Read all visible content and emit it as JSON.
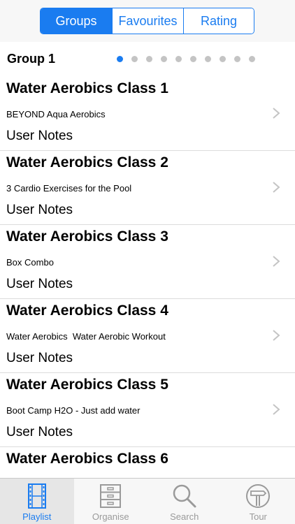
{
  "segmented_control": {
    "segments": [
      {
        "label": "Groups",
        "active": true
      },
      {
        "label": "Favourites",
        "active": false
      },
      {
        "label": "Rating",
        "active": false
      }
    ]
  },
  "group": {
    "title": "Group 1",
    "page_count": 10,
    "current_page": 1
  },
  "playlist": [
    {
      "title": "Water Aerobics Class 1",
      "subtitle": "BEYOND Aqua Aerobics",
      "notes": "User Notes"
    },
    {
      "title": "Water Aerobics Class 2",
      "subtitle": "3 Cardio Exercises for the Pool",
      "notes": "User Notes"
    },
    {
      "title": "Water Aerobics Class 3",
      "subtitle": "Box Combo",
      "notes": "User Notes"
    },
    {
      "title": "Water Aerobics Class 4",
      "subtitle": "Water Aerobics  Water Aerobic Workout",
      "notes": "User Notes"
    },
    {
      "title": "Water Aerobics Class 5",
      "subtitle": "Boot Camp H2O - Just add water",
      "notes": "User Notes"
    },
    {
      "title": "Water Aerobics Class 6",
      "subtitle": "",
      "notes": ""
    }
  ],
  "tab_bar": {
    "tabs": [
      {
        "label": "Playlist",
        "icon": "film-strip-icon",
        "active": true
      },
      {
        "label": "Organise",
        "icon": "filing-cabinet-icon",
        "active": false
      },
      {
        "label": "Search",
        "icon": "magnifier-icon",
        "active": false
      },
      {
        "label": "Tour",
        "icon": "signpost-icon",
        "active": false
      }
    ]
  },
  "colors": {
    "accent": "#1a7cf0",
    "inactive_dot": "#c4c4c4",
    "inactive_tab": "#9a9a9a",
    "separator": "#dcdcdc"
  }
}
